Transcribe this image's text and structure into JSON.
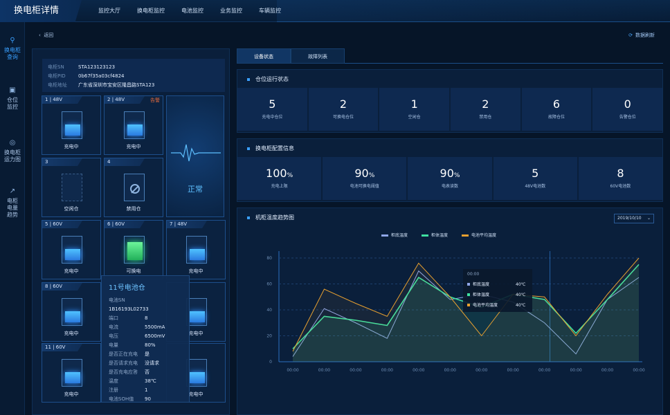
{
  "app_title": "换电柜详情",
  "nav": [
    "监控大厅",
    "换电柜监控",
    "电池监控",
    "业务监控",
    "车辆监控"
  ],
  "sidebar": [
    {
      "label1": "换电柜",
      "label2": "查询",
      "icon": "search-icon",
      "active": true
    },
    {
      "label1": "仓位",
      "label2": "监控",
      "icon": "chart-icon",
      "active": false
    },
    {
      "label1": "换电柜",
      "label2": "运力图",
      "icon": "target-icon",
      "active": false
    },
    {
      "label1": "电柜",
      "label2": "电量",
      "label3": "趋势",
      "icon": "trend-icon",
      "active": false
    }
  ],
  "back": "返回",
  "refresh": "数据刷新",
  "cabinet": {
    "sn_label": "电柜SN",
    "sn": "STA123123123",
    "pid_label": "电柜PID",
    "pid": "0b67f35a03cf4824",
    "addr_label": "电柜地址",
    "addr": "广东省深圳市宝安区隆昌路STA123"
  },
  "cells": [
    {
      "no": "1",
      "v": "48V",
      "status": "充电中"
    },
    {
      "no": "2",
      "v": "48V",
      "status": "充电中",
      "alarm": "告警"
    },
    {
      "no": "3",
      "v": "",
      "status": "空闲仓"
    },
    {
      "no": "4",
      "v": "",
      "status": "禁用仓"
    },
    {
      "no": "5",
      "v": "60V",
      "status": "充电中"
    },
    {
      "no": "6",
      "v": "60V",
      "status": "可换电"
    },
    {
      "no": "7",
      "v": "48V",
      "status": "充电中"
    },
    {
      "no": "8",
      "v": "60V",
      "status": "充电中"
    },
    {
      "no": "11",
      "v": "60V",
      "status": "充电中"
    }
  ],
  "cell_right_labels": [
    "充电中",
    "充电中"
  ],
  "normal_status": "正常",
  "popup": {
    "title": "11号电池仓",
    "rows": [
      {
        "k": "电池SN",
        "v": "1B16193L02733"
      },
      {
        "k": "端口",
        "v": "8"
      },
      {
        "k": "电流",
        "v": "5500mA"
      },
      {
        "k": "电压",
        "v": "6500mV"
      },
      {
        "k": "电量",
        "v": "80%"
      },
      {
        "k": "是否正在充电",
        "v": "是"
      },
      {
        "k": "是否请求充电",
        "v": "没请求"
      },
      {
        "k": "是否充电应答",
        "v": "否"
      },
      {
        "k": "温度",
        "v": "38℃"
      },
      {
        "k": "注册",
        "v": "1"
      },
      {
        "k": "电池SOH值",
        "v": "90"
      }
    ]
  },
  "tabs": [
    "设备状态",
    "故障列表"
  ],
  "section1": {
    "title": "仓位运行状态",
    "stats": [
      {
        "v": "5",
        "l": "充电中仓位"
      },
      {
        "v": "2",
        "l": "可换电仓位"
      },
      {
        "v": "1",
        "l": "空闲仓"
      },
      {
        "v": "2",
        "l": "禁用仓"
      },
      {
        "v": "6",
        "l": "故障仓位"
      },
      {
        "v": "0",
        "l": "告警仓位"
      }
    ]
  },
  "section2": {
    "title": "换电柜配置信息",
    "stats": [
      {
        "v": "100",
        "u": "%",
        "l": "充电上限"
      },
      {
        "v": "90",
        "u": "%",
        "l": "电池可换电阈值"
      },
      {
        "v": "90",
        "u": "%",
        "l": "电表读数"
      },
      {
        "v": "5",
        "u": "",
        "l": "48V电池数"
      },
      {
        "v": "8",
        "u": "",
        "l": "60V电池数"
      }
    ]
  },
  "section3": {
    "title": "机柜温度趋势图",
    "date": "2019/10/10"
  },
  "colors": {
    "s1": "#8fa6e8",
    "s2": "#3fe0a0",
    "s3": "#e8a030"
  },
  "chart_data": {
    "type": "line",
    "x": [
      "00:00",
      "00:00",
      "00:00",
      "00:00",
      "00:00",
      "00:00",
      "00:00",
      "00:00",
      "00:00",
      "00:00",
      "00:00",
      "00:00"
    ],
    "yticks": [
      "0",
      "20",
      "40",
      "60",
      "80"
    ],
    "ylim": [
      0,
      80
    ],
    "series": [
      {
        "name": "柜底温度",
        "values": [
          4,
          41,
          30,
          18,
          70,
          48,
          52,
          46,
          30,
          6,
          48,
          65
        ]
      },
      {
        "name": "柜体温度",
        "values": [
          10,
          35,
          32,
          28,
          65,
          50,
          42,
          52,
          48,
          22,
          48,
          75
        ]
      },
      {
        "name": "电池平均温度",
        "values": [
          8,
          56,
          45,
          35,
          76,
          50,
          20,
          52,
          50,
          20,
          52,
          80
        ]
      }
    ],
    "tooltip": {
      "time": "00:00",
      "rows": [
        {
          "name": "柜底温度",
          "v": "40℃"
        },
        {
          "name": "柜体温度",
          "v": "40℃"
        },
        {
          "name": "电池平均温度",
          "v": "40℃"
        }
      ]
    }
  }
}
